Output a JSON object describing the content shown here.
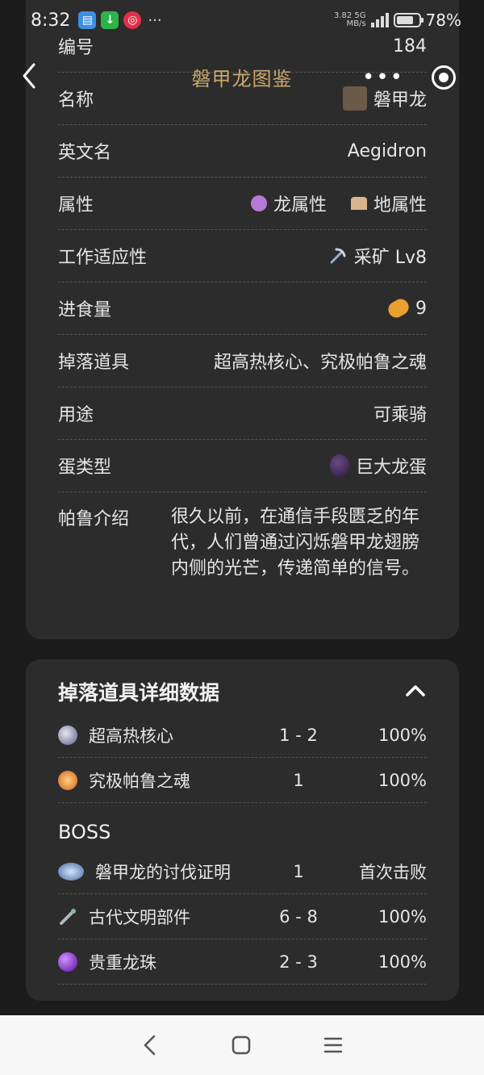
{
  "status_bar": {
    "time": "8:32",
    "net_speed": "3.82",
    "net_unit": "MB/s",
    "net_type": "5G",
    "battery": "78%"
  },
  "header": {
    "title": "磐甲龙图鉴",
    "back_icon": "chevron-left-icon",
    "more_icon": "more-dots-icon",
    "close_icon": "target-icon"
  },
  "info": {
    "number": {
      "label": "编号",
      "value": "184"
    },
    "name": {
      "label": "名称",
      "value": "磐甲龙"
    },
    "english": {
      "label": "英文名",
      "value": "Aegidron"
    },
    "attributes": {
      "label": "属性",
      "values": [
        "龙属性",
        "地属性"
      ]
    },
    "work": {
      "label": "工作适应性",
      "value": "采矿 Lv8"
    },
    "food": {
      "label": "进食量",
      "value": "9"
    },
    "drops": {
      "label": "掉落道具",
      "value": "超高热核心、究极帕鲁之魂"
    },
    "usage": {
      "label": "用途",
      "value": "可乘骑"
    },
    "egg": {
      "label": "蛋类型",
      "value": "巨大龙蛋"
    },
    "intro": {
      "label": "帕鲁介绍",
      "value": "很久以前，在通信手段匮乏的年代，人们曾通过闪烁磐甲龙翅膀内侧的光芒，传递简单的信号。"
    }
  },
  "drop_details": {
    "title": "掉落道具详细数据",
    "items": [
      {
        "name": "超高热核心",
        "qty": "1 - 2",
        "rate": "100%",
        "icon": "core-icon",
        "color": "#8c96c8"
      },
      {
        "name": "究极帕鲁之魂",
        "qty": "1",
        "rate": "100%",
        "icon": "soul-icon",
        "color": "#e08a2a"
      }
    ],
    "boss_title": "BOSS",
    "boss_items": [
      {
        "name": "磐甲龙的讨伐证明",
        "qty": "1",
        "rate": "首次击败",
        "icon": "medal-icon",
        "color": "#7fa6d8"
      },
      {
        "name": "古代文明部件",
        "qty": "6 - 8",
        "rate": "100%",
        "icon": "ancient-part-icon",
        "color": "#9aa0a8"
      },
      {
        "name": "贵重龙珠",
        "qty": "2 - 3",
        "rate": "100%",
        "icon": "dragon-orb-icon",
        "color": "#8a2bd0"
      }
    ]
  },
  "colors": {
    "background": "#1c1c1c",
    "card": "#2c2c2c",
    "title_gold": "#c9a86a"
  }
}
